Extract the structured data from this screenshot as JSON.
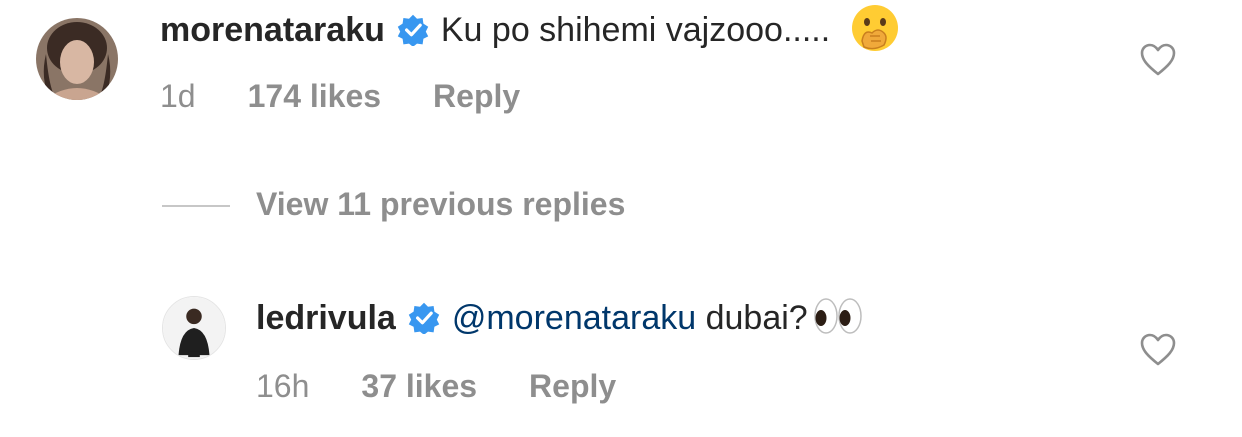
{
  "comment": {
    "username": "morenataraku",
    "text": "Ku po shihemi vajzooo.....",
    "emoji": "🤭",
    "time": "1d",
    "likes": "174 likes",
    "reply": "Reply"
  },
  "view_replies": "View 11 previous replies",
  "reply": {
    "username": "ledrivula",
    "mention": "@morenataraku",
    "text": "dubai?",
    "emoji": "👀",
    "time": "16h",
    "likes": "37 likes",
    "reply_label": "Reply"
  },
  "colors": {
    "verified": "#3897f0",
    "mention": "#00376b",
    "meta": "#8e8e8e"
  }
}
